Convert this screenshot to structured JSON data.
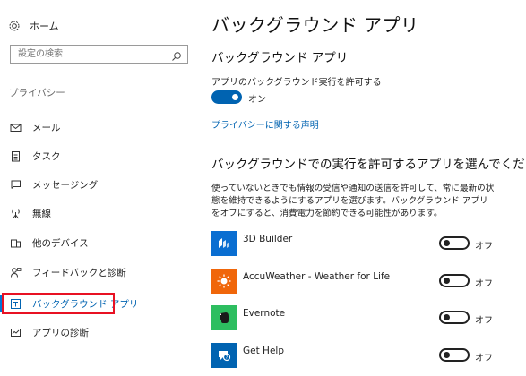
{
  "sidebar": {
    "home": {
      "label": "ホーム",
      "icon": "gear-icon"
    },
    "search": {
      "placeholder": "設定の検索",
      "icon": "search-icon"
    },
    "section_label": "プライバシー",
    "items": [
      {
        "label": "メール",
        "icon": "mail-icon",
        "selected": false
      },
      {
        "label": "タスク",
        "icon": "task-icon",
        "selected": false
      },
      {
        "label": "メッセージング",
        "icon": "chat-icon",
        "selected": false
      },
      {
        "label": "無線",
        "icon": "radio-antenna-icon",
        "selected": false
      },
      {
        "label": "他のデバイス",
        "icon": "devices-icon",
        "selected": false
      },
      {
        "label": "フィードバックと診断",
        "icon": "feedback-icon",
        "selected": false
      },
      {
        "label": "バックグラウンド アプリ",
        "icon": "background-apps-icon",
        "selected": true
      },
      {
        "label": "アプリの診断",
        "icon": "diagnostics-icon",
        "selected": false
      }
    ]
  },
  "main": {
    "title": "バックグラウンド アプリ",
    "section_title": "バックグラウンド アプリ",
    "allow_label": "アプリのバックグラウンド実行を許可する",
    "allow_toggle": {
      "state": "on",
      "label": "オン"
    },
    "privacy_link": "プライバシーに関する声明",
    "choose_title": "バックグラウンドでの実行を許可するアプリを選んでください",
    "description": "使っていないときでも情報の受信や通知の送信を許可して、常に最新の状態を維持できるようにするアプリを選びます。バックグラウンド アプリをオフにすると、消費電力を節約できる可能性があります。",
    "apps": [
      {
        "name": "3D Builder",
        "toggle_label": "オフ",
        "state": "off",
        "icon": "3d-builder-icon",
        "color": "#0a6ed1"
      },
      {
        "name": "AccuWeather - Weather for Life",
        "toggle_label": "オフ",
        "state": "off",
        "icon": "sun-icon",
        "color": "#f0660a"
      },
      {
        "name": "Evernote",
        "toggle_label": "オフ",
        "state": "off",
        "icon": "evernote-elephant-icon",
        "color": "#2dbe60"
      },
      {
        "name": "Get Help",
        "toggle_label": "オフ",
        "state": "off",
        "icon": "get-help-icon",
        "color": "#0063b1"
      }
    ]
  },
  "colors": {
    "accent": "#0063b1",
    "selection_outline": "#e81123"
  }
}
